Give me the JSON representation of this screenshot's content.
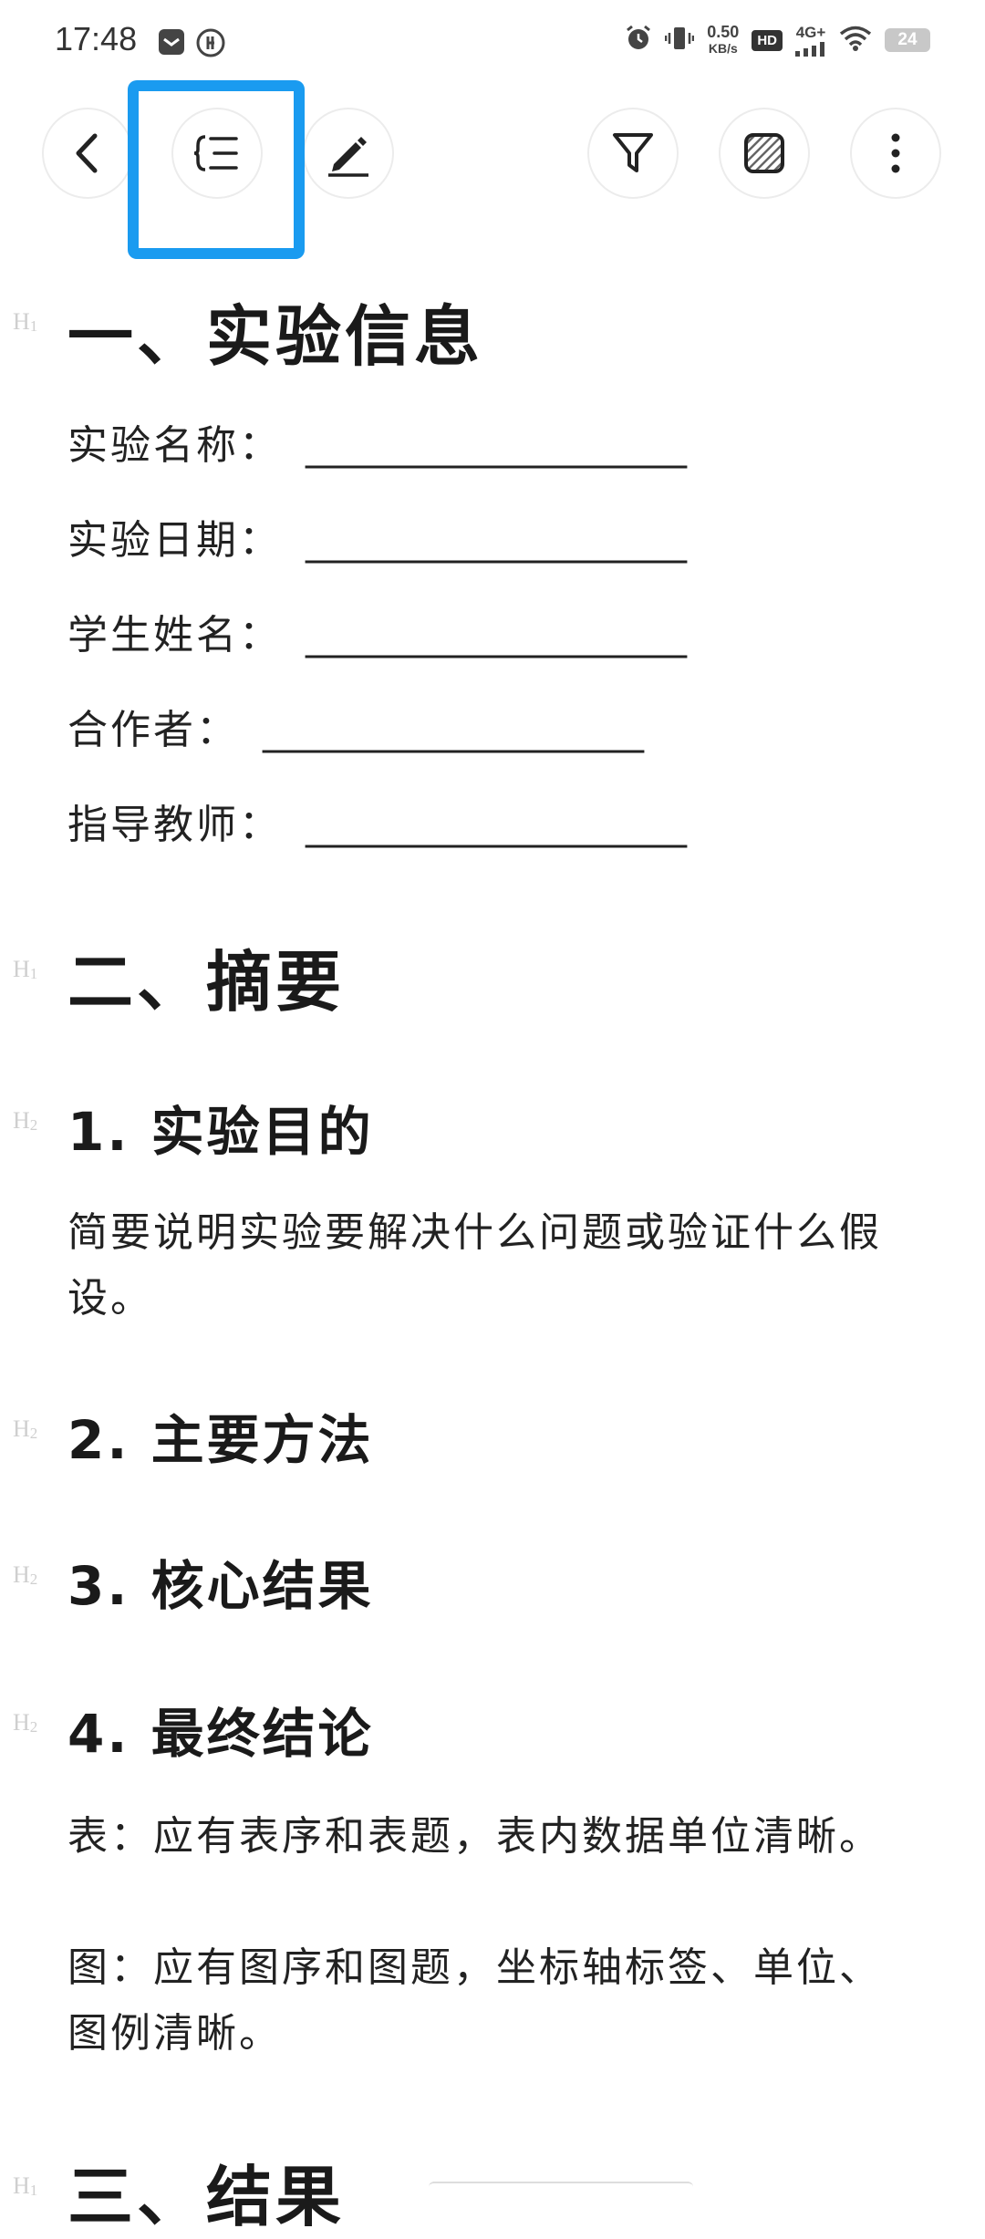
{
  "status_bar": {
    "time": "17:48",
    "net_speed_value": "0.50",
    "net_speed_unit": "KB/s",
    "hd_badge": "HD",
    "network": "4G+",
    "battery": "24"
  },
  "toolbar": {
    "back_icon": "chevron-left-icon",
    "outline_icon": "outline-list-icon",
    "edit_icon": "pencil-icon",
    "filter_icon": "filter-icon",
    "theme_icon": "hatched-square-icon",
    "more_icon": "more-vertical-icon",
    "highlight_color": "#1a9bf0"
  },
  "document": {
    "h1_marker": "H",
    "h1_marker_level": "1",
    "h2_marker_level": "2",
    "section1": {
      "title": "一、实验信息",
      "fields": [
        {
          "label": "实验名称：",
          "blank": "___________________"
        },
        {
          "label": "实验日期：",
          "blank": "___________________"
        },
        {
          "label": "学生姓名：",
          "blank": "___________________"
        },
        {
          "label": "合作者：",
          "blank": "___________________"
        },
        {
          "label": "指导教师：",
          "blank": "___________________"
        }
      ]
    },
    "section2": {
      "title": "二、摘要",
      "sub1": {
        "title": "1. 实验目的",
        "body": "简要说明实验要解决什么问题或验证什么假设。"
      },
      "sub2": {
        "title": "2. 主要方法"
      },
      "sub3": {
        "title": "3. 核心结果"
      },
      "sub4": {
        "title": "4. 最终结论",
        "body1": "表：应有表序和表题，表内数据单位清晰。",
        "body2": "图：应有图序和图题，坐标轴标签、单位、图例清晰。"
      }
    },
    "section3": {
      "title": "三、结果"
    }
  }
}
